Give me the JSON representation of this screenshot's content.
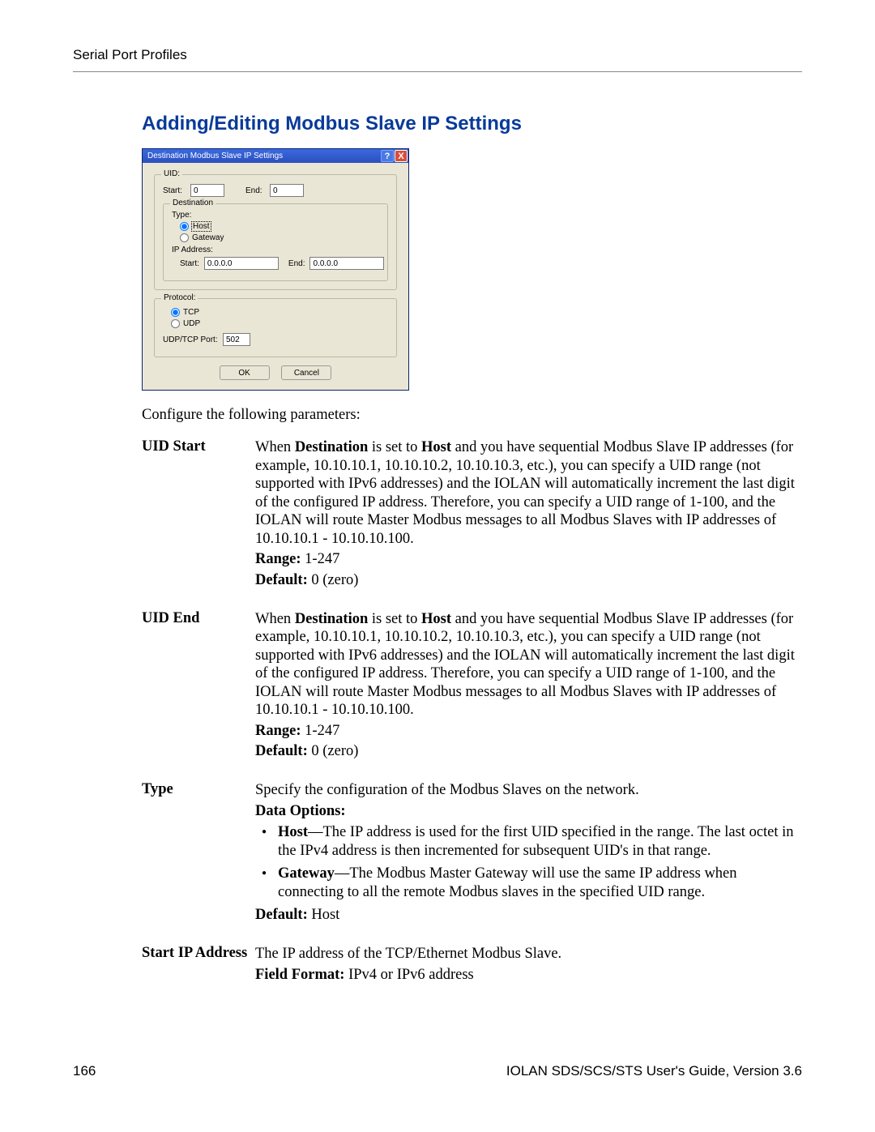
{
  "header": {
    "text": "Serial Port Profiles"
  },
  "heading": "Adding/Editing Modbus Slave IP Settings",
  "dialog": {
    "title": "Destination Modbus Slave IP Settings",
    "help": "?",
    "close": "X",
    "uid": {
      "legend": "UID:",
      "start_label": "Start:",
      "start_value": "0",
      "end_label": "End:",
      "end_value": "0"
    },
    "dest": {
      "legend": "Destination",
      "type_label": "Type:",
      "host": "Host",
      "gateway": "Gateway",
      "ip_label": "IP Address:",
      "ip_start_label": "Start:",
      "ip_start_value": "0.0.0.0",
      "ip_end_label": "End:",
      "ip_end_value": "0.0.0.0"
    },
    "proto": {
      "legend": "Protocol:",
      "tcp": "TCP",
      "udp": "UDP",
      "port_label": "UDP/TCP Port:",
      "port_value": "502"
    },
    "ok": "OK",
    "cancel": "Cancel"
  },
  "intro": "Configure the following parameters:",
  "params": {
    "uid_start": {
      "name": "UID Start",
      "desc_pre": "When ",
      "desc_b1": "Destination",
      "desc_mid": " is set to ",
      "desc_b2": "Host",
      "desc_tail": " and you have sequential Modbus Slave IP addresses (for example, 10.10.10.1, 10.10.10.2, 10.10.10.3, etc.), you can specify a UID range (not supported with IPv6 addresses) and the IOLAN will automatically increment the last digit of the configured IP address. Therefore, you can specify a UID range of 1-100, and the IOLAN will route Master Modbus messages to all Modbus Slaves with IP addresses of 10.10.10.1 - 10.10.10.100.",
      "range_label": "Range:",
      "range": " 1-247",
      "default_label": "Default:",
      "default": " 0 (zero)"
    },
    "uid_end": {
      "name": "UID End",
      "desc_pre": "When ",
      "desc_b1": "Destination",
      "desc_mid": " is set to ",
      "desc_b2": "Host",
      "desc_tail": " and you have sequential Modbus Slave IP addresses (for example, 10.10.10.1, 10.10.10.2, 10.10.10.3, etc.), you can specify a UID range (not supported with IPv6 addresses) and the IOLAN will automatically increment the last digit of the configured IP address. Therefore, you can specify a UID range of 1-100, and the IOLAN will route Master Modbus messages to all Modbus Slaves with IP addresses of 10.10.10.1 - 10.10.10.100.",
      "range_label": "Range:",
      "range": " 1-247",
      "default_label": "Default:",
      "default": " 0 (zero)"
    },
    "type": {
      "name": "Type",
      "desc": "Specify the configuration of the Modbus Slaves on the network.",
      "opts_label": "Data Options:",
      "opt1_b": "Host",
      "opt1": "—The IP address is used for the first UID specified in the range. The last octet in the IPv4 address is then incremented for subsequent UID's in that range.",
      "opt2_b": "Gateway",
      "opt2": "—The Modbus Master Gateway will use the same IP address when connecting to all the remote Modbus slaves in the specified UID range.",
      "default_label": "Default:",
      "default": " Host"
    },
    "start_ip": {
      "name": "Start IP Address",
      "desc": "The IP address of the TCP/Ethernet Modbus Slave.",
      "ff_label": "Field Format:",
      "ff": " IPv4 or IPv6 address"
    }
  },
  "footer": {
    "page": "166",
    "doc": "IOLAN SDS/SCS/STS User's Guide, Version 3.6"
  }
}
